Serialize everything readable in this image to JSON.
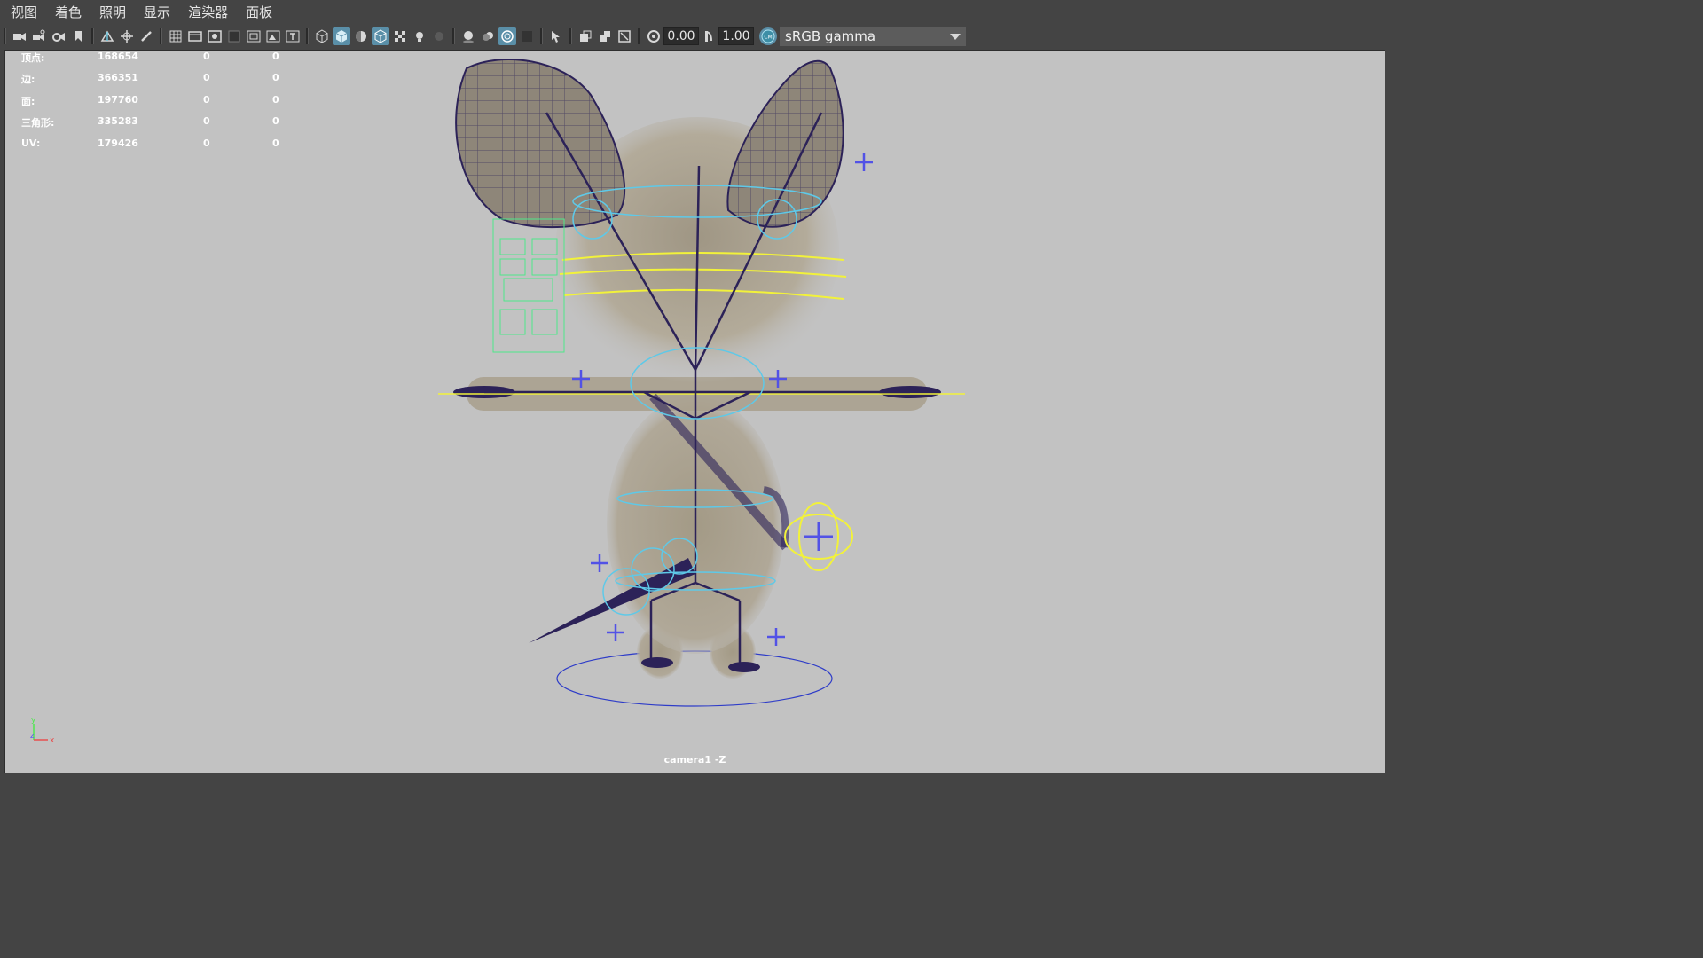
{
  "menu": [
    "视图",
    "着色",
    "照明",
    "显示",
    "渲染器",
    "面板"
  ],
  "toolbar": {
    "exposure_value": "0.00",
    "gamma_value": "1.00",
    "color_management_label": "sRGB gamma",
    "color_management_toggle_icon": "cm-toggle-icon",
    "icons": [
      "camera-icon",
      "camera-lock-icon",
      "camera-attr-icon",
      "bookmark-icon",
      "image-plane-icon",
      "2d-pan-zoom-icon",
      "grease-pencil-icon",
      "grid-icon",
      "film-gate-icon",
      "resolution-gate-icon",
      "gate-mask-icon",
      "field-chart-icon",
      "safe-action-icon",
      "safe-title-icon",
      "wireframe-icon",
      "smooth-shade-icon",
      "default-material-icon",
      "wireframe-on-shaded-icon",
      "textured-icon",
      "use-all-lights-icon",
      "shadows-icon",
      "screen-space-ao-icon",
      "motion-blur-icon",
      "anti-aliasing-icon",
      "depth-of-field-icon",
      "isolate-select-icon",
      "xray-icon",
      "xray-active-icon",
      "xray-joints-icon",
      "backface-culling-icon",
      "exposure-icon",
      "gamma-icon",
      "view-transform-icon"
    ]
  },
  "hud": {
    "rows": [
      {
        "label": "顶点:",
        "v1": "168654",
        "v2": "0",
        "v3": "0"
      },
      {
        "label": "边:",
        "v1": "366351",
        "v2": "0",
        "v3": "0"
      },
      {
        "label": "面:",
        "v1": "197760",
        "v2": "0",
        "v3": "0"
      },
      {
        "label": "三角形:",
        "v1": "335283",
        "v2": "0",
        "v3": "0"
      },
      {
        "label": "UV:",
        "v1": "179426",
        "v2": "0",
        "v3": "0"
      }
    ]
  },
  "viewport": {
    "camera_label": "camera1 -Z",
    "axis": {
      "y": "y",
      "z": "z",
      "x": "x"
    }
  },
  "colors": {
    "viewport_bg": "#c2c2c2",
    "ui_bg": "#444444",
    "fur": "#a9a291",
    "joint": "#2c2258",
    "control_cyan": "#5ec9e8",
    "control_yellow": "#f2f23a",
    "locator_blue": "#5252e6",
    "picker_green": "#4fe88a"
  }
}
